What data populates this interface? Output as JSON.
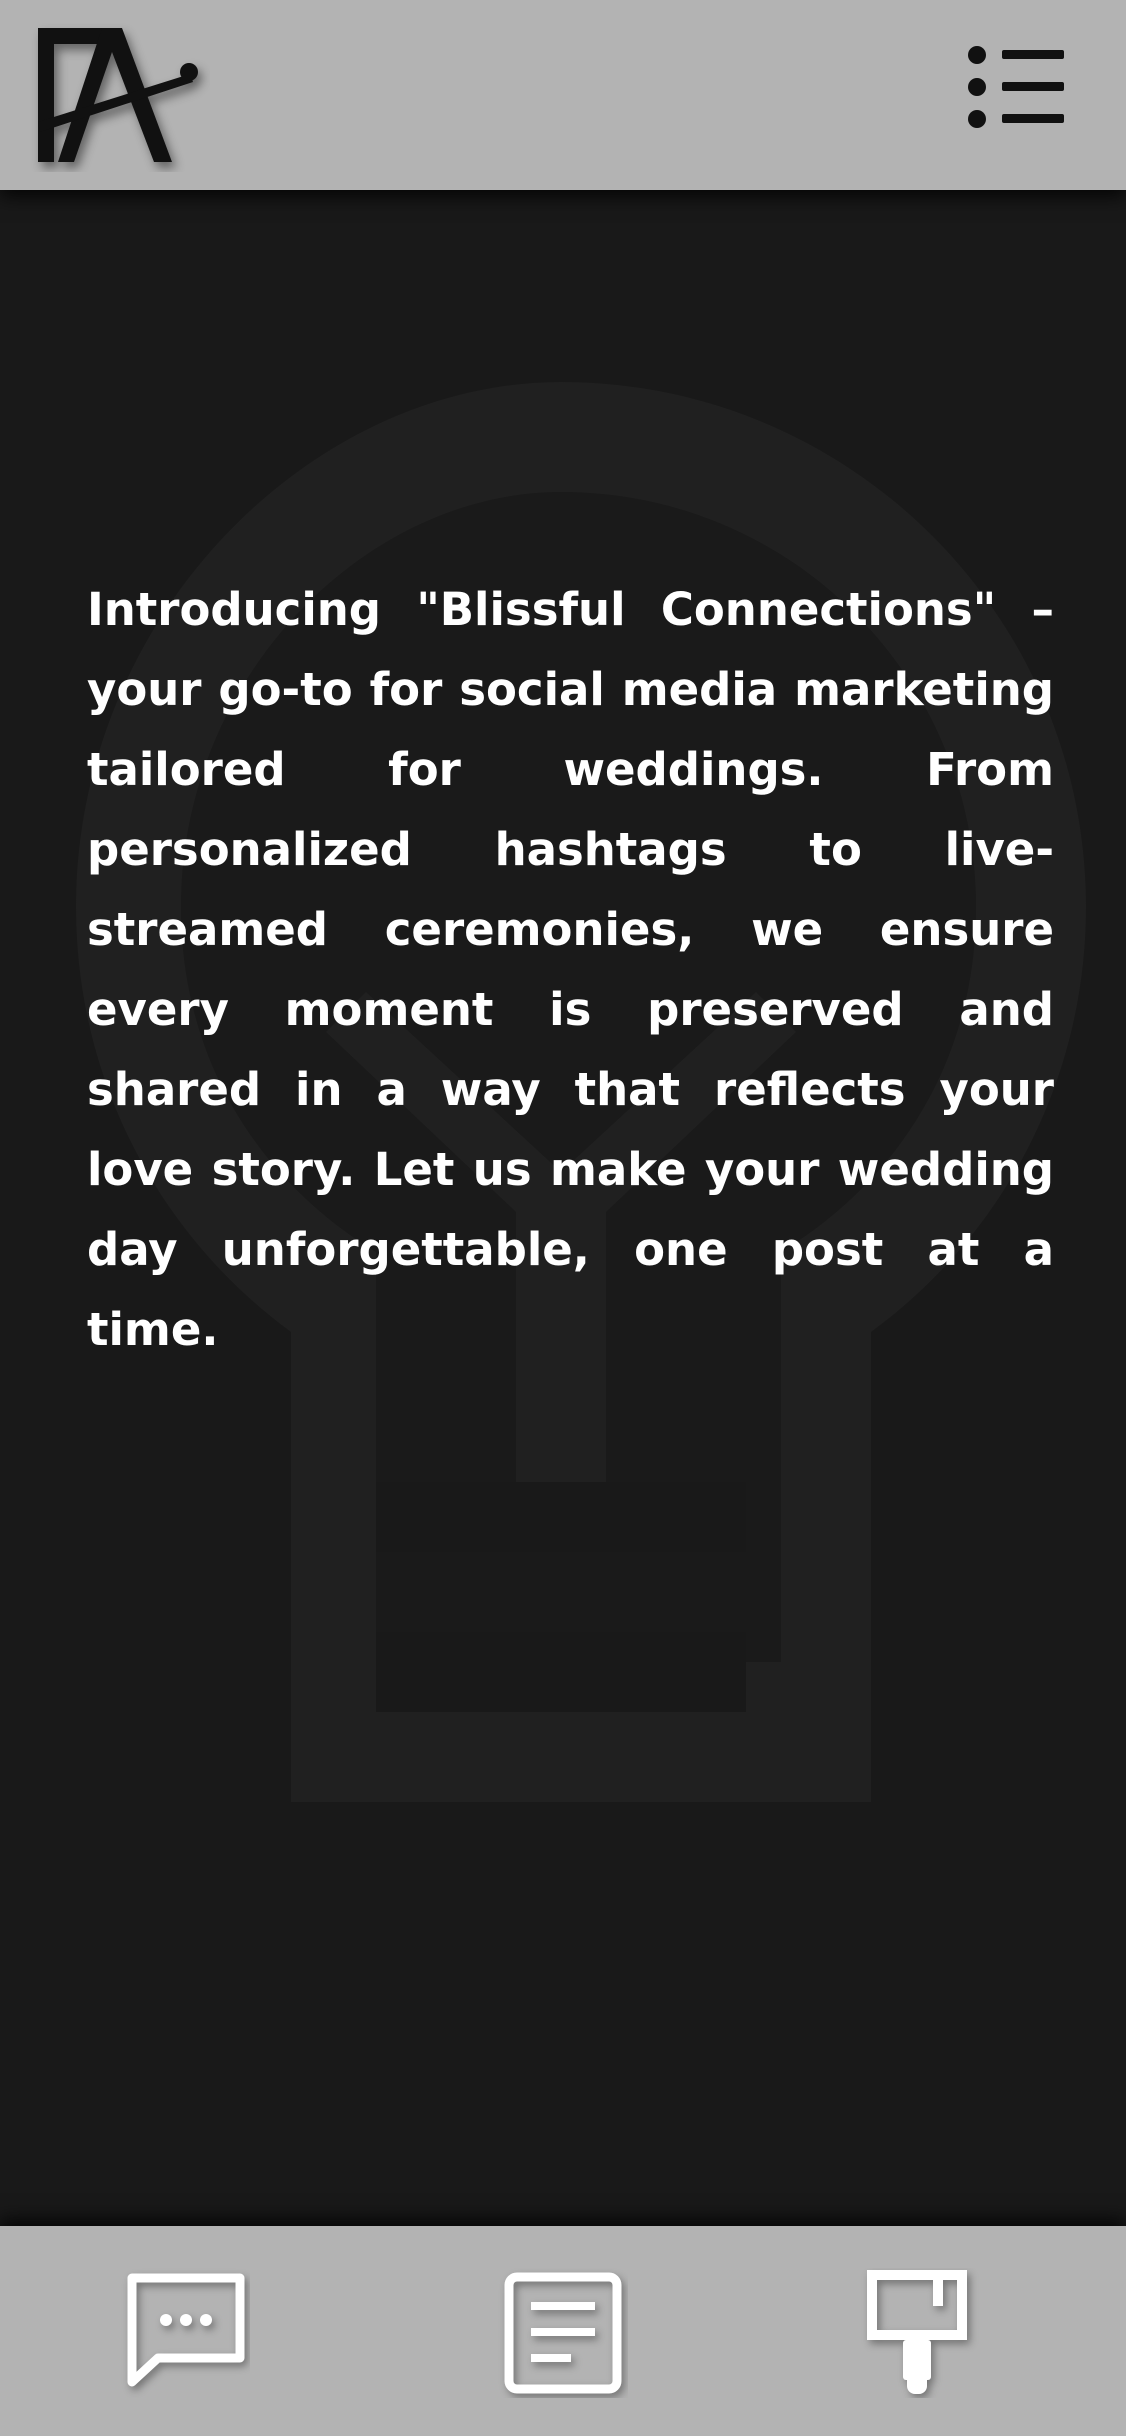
{
  "header": {
    "logo_text": "FA",
    "logo_icon": "fa-monogram-logo",
    "menu_icon": "menu-icon"
  },
  "main": {
    "background_icon": "lightbulb-icon",
    "intro_text": "Introducing \"Blissful Connections\" – your go-to for social media marketing tailored for weddings. From personalized hashtags to live-streamed ceremonies, we ensure every moment is preserved and shared in a way that reflects your love story. Let us make your wedding day unforgettable, one post at a time."
  },
  "bottom_nav": {
    "items": [
      {
        "icon": "chat-bubble-icon"
      },
      {
        "icon": "document-icon"
      },
      {
        "icon": "paint-brush-icon"
      }
    ]
  },
  "colors": {
    "bar_background": "#b3b3b3",
    "page_background": "#191919",
    "text": "#ffffff",
    "icon_dark": "#111111",
    "icon_light": "#ffffff"
  }
}
